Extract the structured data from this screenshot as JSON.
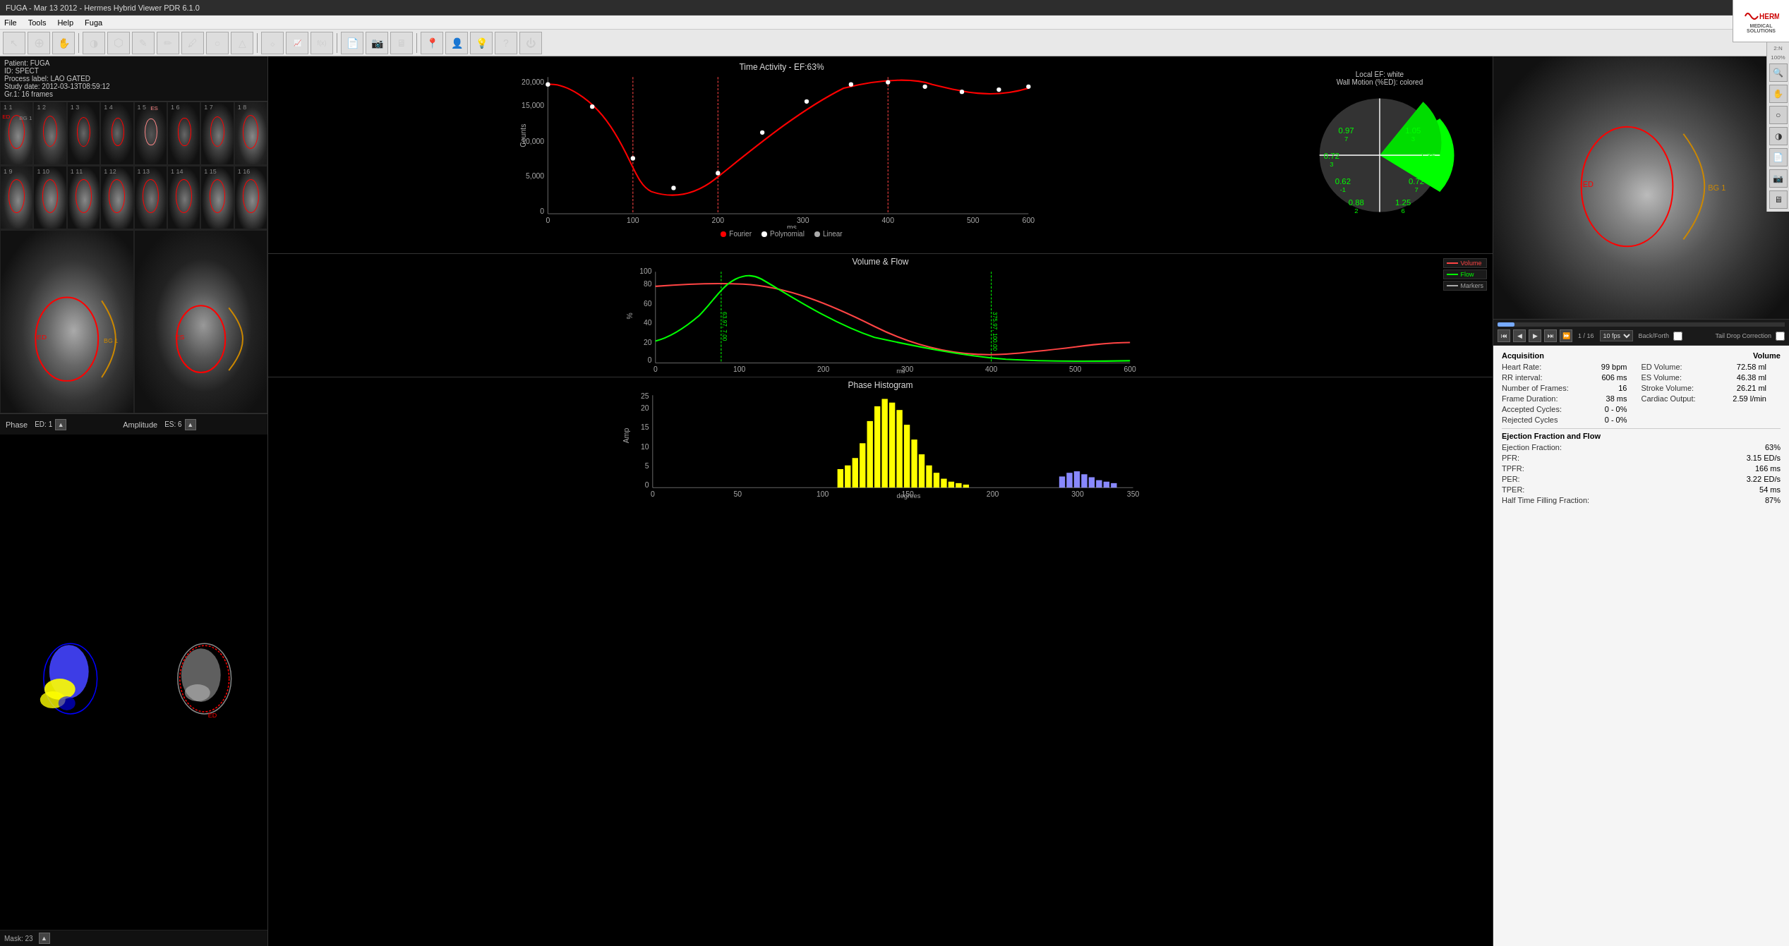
{
  "titleBar": {
    "title": "FUGA - Mar 13 2012 - Hermes Hybrid Viewer PDR 6.1.0",
    "minimize": "─",
    "maximize": "□",
    "close": "✕"
  },
  "menuBar": {
    "items": [
      "File",
      "Tools",
      "Help",
      "Fuga"
    ]
  },
  "toolbar": {
    "tools": [
      {
        "name": "pointer",
        "icon": "↖",
        "label": "Pointer"
      },
      {
        "name": "zoom",
        "icon": "🔍",
        "label": "Zoom"
      },
      {
        "name": "pan",
        "icon": "✋",
        "label": "Pan"
      },
      {
        "name": "invert",
        "icon": "◑",
        "label": "Invert"
      },
      {
        "name": "roi",
        "icon": "⬡",
        "label": "ROI"
      },
      {
        "name": "draw",
        "icon": "✏",
        "label": "Draw"
      },
      {
        "name": "annotate",
        "icon": "📝",
        "label": "Annotate"
      },
      {
        "name": "edit",
        "icon": "🖊",
        "label": "Edit"
      },
      {
        "name": "ellipse",
        "icon": "○",
        "label": "Ellipse"
      },
      {
        "name": "polygon",
        "icon": "△",
        "label": "Polygon"
      },
      {
        "name": "filter",
        "icon": "⬦",
        "label": "Filter"
      },
      {
        "name": "profile",
        "icon": "📈",
        "label": "Profile"
      },
      {
        "name": "function",
        "icon": "f(x)",
        "label": "Function"
      },
      {
        "name": "report",
        "icon": "📄",
        "label": "Report"
      },
      {
        "name": "capture",
        "icon": "📷",
        "label": "Capture"
      },
      {
        "name": "screen",
        "icon": "🖥",
        "label": "Screen"
      },
      {
        "name": "marker",
        "icon": "📍",
        "label": "Marker"
      },
      {
        "name": "user",
        "icon": "👤",
        "label": "User"
      },
      {
        "name": "bulb",
        "icon": "💡",
        "label": "Bulb"
      },
      {
        "name": "help",
        "icon": "?",
        "label": "Help"
      },
      {
        "name": "power",
        "icon": "⏻",
        "label": "Power"
      }
    ]
  },
  "patientInfo": {
    "patient": "Patient: FUGA",
    "id": "ID: SPECT",
    "processLabel": "Process label: LAO GATED",
    "studyDate": "Study date: 2012-03-13T08:59:12",
    "gating": "Gr.1: 16 frames"
  },
  "zoomInfo": {
    "level": "2:N",
    "percent": "100%"
  },
  "gatedFrames": {
    "count": 16,
    "rows": [
      [
        1,
        2,
        3,
        4,
        5,
        6,
        7,
        8
      ],
      [
        9,
        10,
        11,
        12,
        13,
        14,
        15,
        16
      ]
    ]
  },
  "timeActivityChart": {
    "title": "Time Activity - EF:63%",
    "xLabel": "ms",
    "yLabel": "Counts",
    "yMax": 20000,
    "yTicks": [
      5000,
      10000,
      15000,
      20000
    ],
    "xMax": 600,
    "legend": [
      {
        "label": "Fourier",
        "color": "#f00"
      },
      {
        "label": "Polynomial",
        "color": "#fff"
      },
      {
        "label": "Linear",
        "color": "#aaa"
      }
    ]
  },
  "polarMapPanel": {
    "title": "Local EF: white",
    "subtitle": "Wall Motion (%ED): colored",
    "values": [
      {
        "pos": "top-left",
        "val": "0.97",
        "num": "7"
      },
      {
        "pos": "top-right",
        "val": "1.05",
        "num": "3"
      },
      {
        "pos": "mid-left",
        "val": "0.72",
        "num": "3"
      },
      {
        "pos": "mid-right",
        "val": "1.36",
        "num": "6"
      },
      {
        "pos": "bot-left",
        "val": "0.62",
        "num": "-1"
      },
      {
        "pos": "bot-right",
        "val": "0.72",
        "num": "7"
      },
      {
        "pos": "bottom-left2",
        "val": "0.88",
        "num": "2"
      },
      {
        "pos": "bottom-right2",
        "val": "1.25",
        "num": "6"
      }
    ]
  },
  "volumeFlowChart": {
    "title": "Volume & Flow",
    "xLabel": "ms",
    "yLabel": "%",
    "yMax": 100,
    "xMax": 600,
    "legend": [
      {
        "label": "Volume",
        "color": "#f44"
      },
      {
        "label": "Flow",
        "color": "#0f0"
      },
      {
        "label": "Markers",
        "color": "#888"
      }
    ]
  },
  "phaseHistogram": {
    "title": "Phase Histogram",
    "xLabel": "degrees",
    "yLabel": "Amp",
    "yMax": 25,
    "xMax": 350
  },
  "phaseImages": {
    "label1": "Phase",
    "label2": "Amplitude",
    "ed1": "ED: 1",
    "es1": "ES: 6",
    "mask": "Mask: 23"
  },
  "playback": {
    "frameInfo": "1 / 16",
    "fps": "10 fps",
    "backForth": "Back/Forth"
  },
  "acquisitionStats": {
    "sectionTitle": "Acquisition",
    "volumeSectionTitle": "Volume",
    "rows": [
      {
        "label": "Heart Rate:",
        "value": "99 bpm",
        "label2": "ED Volume:",
        "value2": "72.58 ml"
      },
      {
        "label": "RR interval:",
        "value": "606 ms",
        "label2": "ES Volume:",
        "value2": "46.38 ml"
      },
      {
        "label": "Number of Frames:",
        "value": "16",
        "label2": "Stroke Volume:",
        "value2": "26.21 ml"
      },
      {
        "label": "Frame Duration:",
        "value": "38 ms",
        "label2": "Cardiac Output:",
        "value2": "2.59 l/min"
      },
      {
        "label": "Accepted Cycles:",
        "value": "0 - 0%",
        "label2": "",
        "value2": ""
      },
      {
        "label": "Rejected Cycles",
        "value": "0 - 0%",
        "label2": "",
        "value2": ""
      }
    ]
  },
  "efStats": {
    "sectionTitle": "Ejection Fraction and Flow",
    "rows": [
      {
        "label": "Ejection Fraction:",
        "value": "63%"
      },
      {
        "label": "PFR:",
        "value": "3.15 ED/s"
      },
      {
        "label": "TPFR:",
        "value": "166 ms"
      },
      {
        "label": "PER:",
        "value": "3.22 ED/s"
      },
      {
        "label": "TPER:",
        "value": "54 ms"
      },
      {
        "label": "Half Time Filling Fraction:",
        "value": "87%"
      }
    ]
  },
  "rightTools": [
    {
      "name": "zoom-in",
      "icon": "🔍"
    },
    {
      "name": "hand",
      "icon": "✋"
    },
    {
      "name": "circle-tool",
      "icon": "○"
    },
    {
      "name": "invert-tool",
      "icon": "◑"
    },
    {
      "name": "page-tool",
      "icon": "📄"
    },
    {
      "name": "camera-tool",
      "icon": "📷"
    },
    {
      "name": "screen-tool",
      "icon": "🖥"
    }
  ]
}
